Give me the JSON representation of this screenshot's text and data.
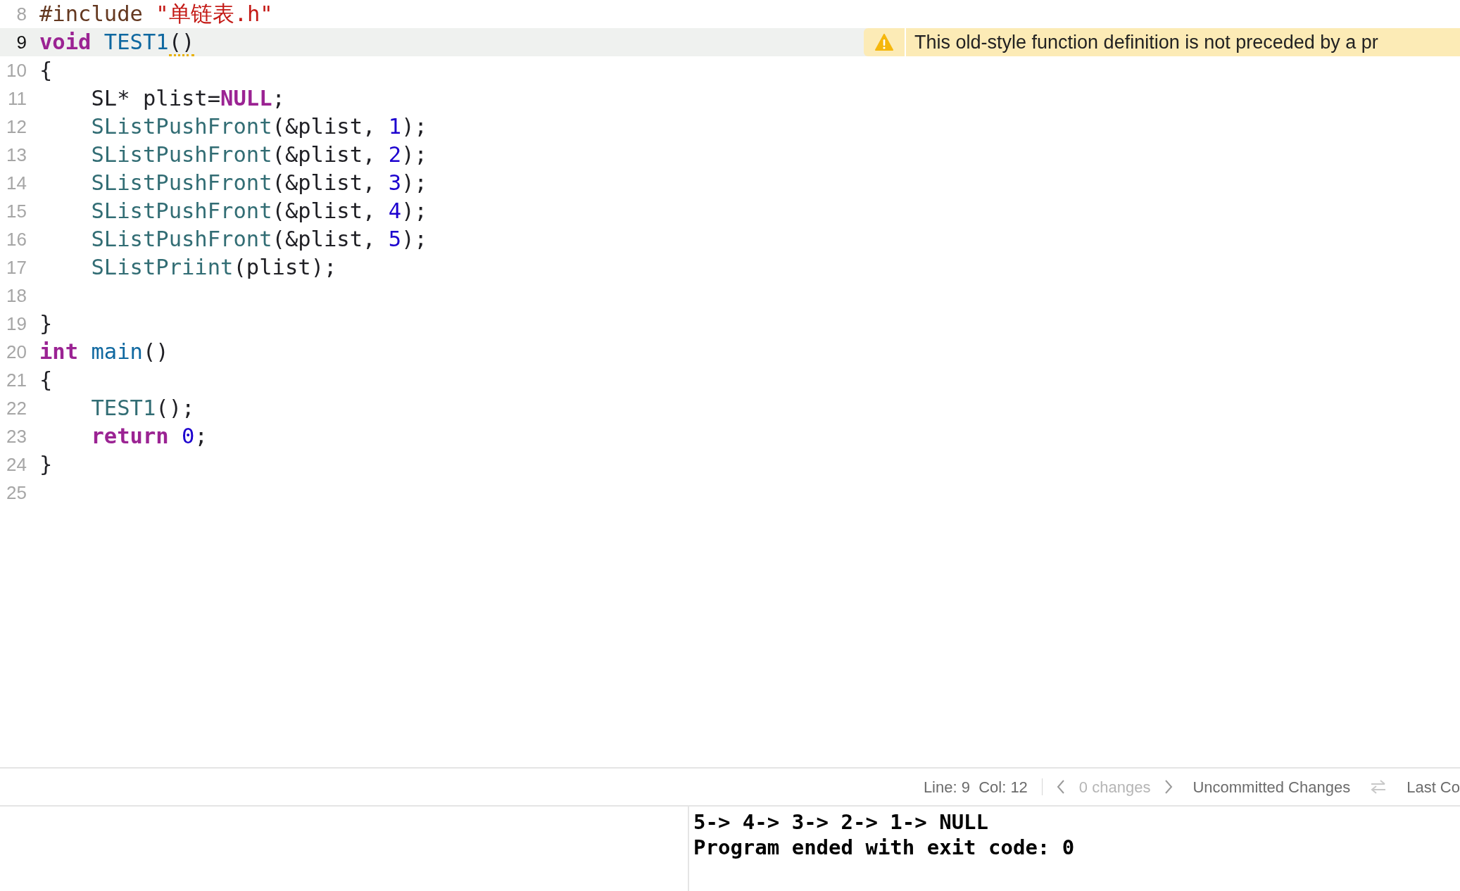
{
  "editor": {
    "lines": [
      {
        "number": "8",
        "current": false,
        "tokens": [
          {
            "kind": "preproc",
            "text": "#include "
          },
          {
            "kind": "string",
            "text": "\"单链表.h\""
          }
        ]
      },
      {
        "number": "9",
        "current": true,
        "tokens": [
          {
            "kind": "keyword",
            "text": "void "
          },
          {
            "kind": "decl",
            "text": "TEST1"
          },
          {
            "kind": "plain",
            "text": "()"
          }
        ],
        "warning": {
          "message": "This old-style function definition is not preceded by a pr"
        }
      },
      {
        "number": "10",
        "current": false,
        "tokens": [
          {
            "kind": "plain",
            "text": "{"
          }
        ]
      },
      {
        "number": "11",
        "current": false,
        "tokens": [
          {
            "kind": "plain",
            "text": "    SL* plist="
          },
          {
            "kind": "keyword",
            "text": "NULL"
          },
          {
            "kind": "plain",
            "text": ";"
          }
        ]
      },
      {
        "number": "12",
        "current": false,
        "tokens": [
          {
            "kind": "call",
            "text": "    SListPushFront"
          },
          {
            "kind": "plain",
            "text": "(&plist, "
          },
          {
            "kind": "number",
            "text": "1"
          },
          {
            "kind": "plain",
            "text": ");"
          }
        ]
      },
      {
        "number": "13",
        "current": false,
        "tokens": [
          {
            "kind": "call",
            "text": "    SListPushFront"
          },
          {
            "kind": "plain",
            "text": "(&plist, "
          },
          {
            "kind": "number",
            "text": "2"
          },
          {
            "kind": "plain",
            "text": ");"
          }
        ]
      },
      {
        "number": "14",
        "current": false,
        "tokens": [
          {
            "kind": "call",
            "text": "    SListPushFront"
          },
          {
            "kind": "plain",
            "text": "(&plist, "
          },
          {
            "kind": "number",
            "text": "3"
          },
          {
            "kind": "plain",
            "text": ");"
          }
        ]
      },
      {
        "number": "15",
        "current": false,
        "tokens": [
          {
            "kind": "call",
            "text": "    SListPushFront"
          },
          {
            "kind": "plain",
            "text": "(&plist, "
          },
          {
            "kind": "number",
            "text": "4"
          },
          {
            "kind": "plain",
            "text": ");"
          }
        ]
      },
      {
        "number": "16",
        "current": false,
        "tokens": [
          {
            "kind": "call",
            "text": "    SListPushFront"
          },
          {
            "kind": "plain",
            "text": "(&plist, "
          },
          {
            "kind": "number",
            "text": "5"
          },
          {
            "kind": "plain",
            "text": ");"
          }
        ]
      },
      {
        "number": "17",
        "current": false,
        "tokens": [
          {
            "kind": "call",
            "text": "    SListPriint"
          },
          {
            "kind": "plain",
            "text": "(plist);"
          }
        ]
      },
      {
        "number": "18",
        "current": false
      },
      {
        "number": "19",
        "current": false,
        "tokens": [
          {
            "kind": "plain",
            "text": "}"
          }
        ]
      },
      {
        "number": "20",
        "current": false,
        "tokens": [
          {
            "kind": "keyword",
            "text": "int "
          },
          {
            "kind": "decl",
            "text": "main"
          },
          {
            "kind": "plain",
            "text": "()"
          }
        ]
      },
      {
        "number": "21",
        "current": false,
        "tokens": [
          {
            "kind": "plain",
            "text": "{"
          }
        ]
      },
      {
        "number": "22",
        "current": false,
        "tokens": [
          {
            "kind": "call",
            "text": "    TEST1"
          },
          {
            "kind": "plain",
            "text": "();"
          }
        ]
      },
      {
        "number": "23",
        "current": false,
        "tokens": [
          {
            "kind": "keyword",
            "text": "    return "
          },
          {
            "kind": "number",
            "text": "0"
          },
          {
            "kind": "plain",
            "text": ";"
          }
        ]
      },
      {
        "number": "24",
        "current": false,
        "tokens": [
          {
            "kind": "plain",
            "text": "}"
          }
        ]
      },
      {
        "number": "25",
        "current": false
      }
    ]
  },
  "status_bar": {
    "position": "Line: 9  Col: 12",
    "changes": {
      "text": "0 changes",
      "disabled": true
    },
    "source_control": "Uncommitted Changes",
    "last": "Last Co"
  },
  "console": {
    "lines": [
      "5-> 4-> 3-> 2-> 1-> NULL",
      "Program ended with exit code: 0"
    ]
  }
}
